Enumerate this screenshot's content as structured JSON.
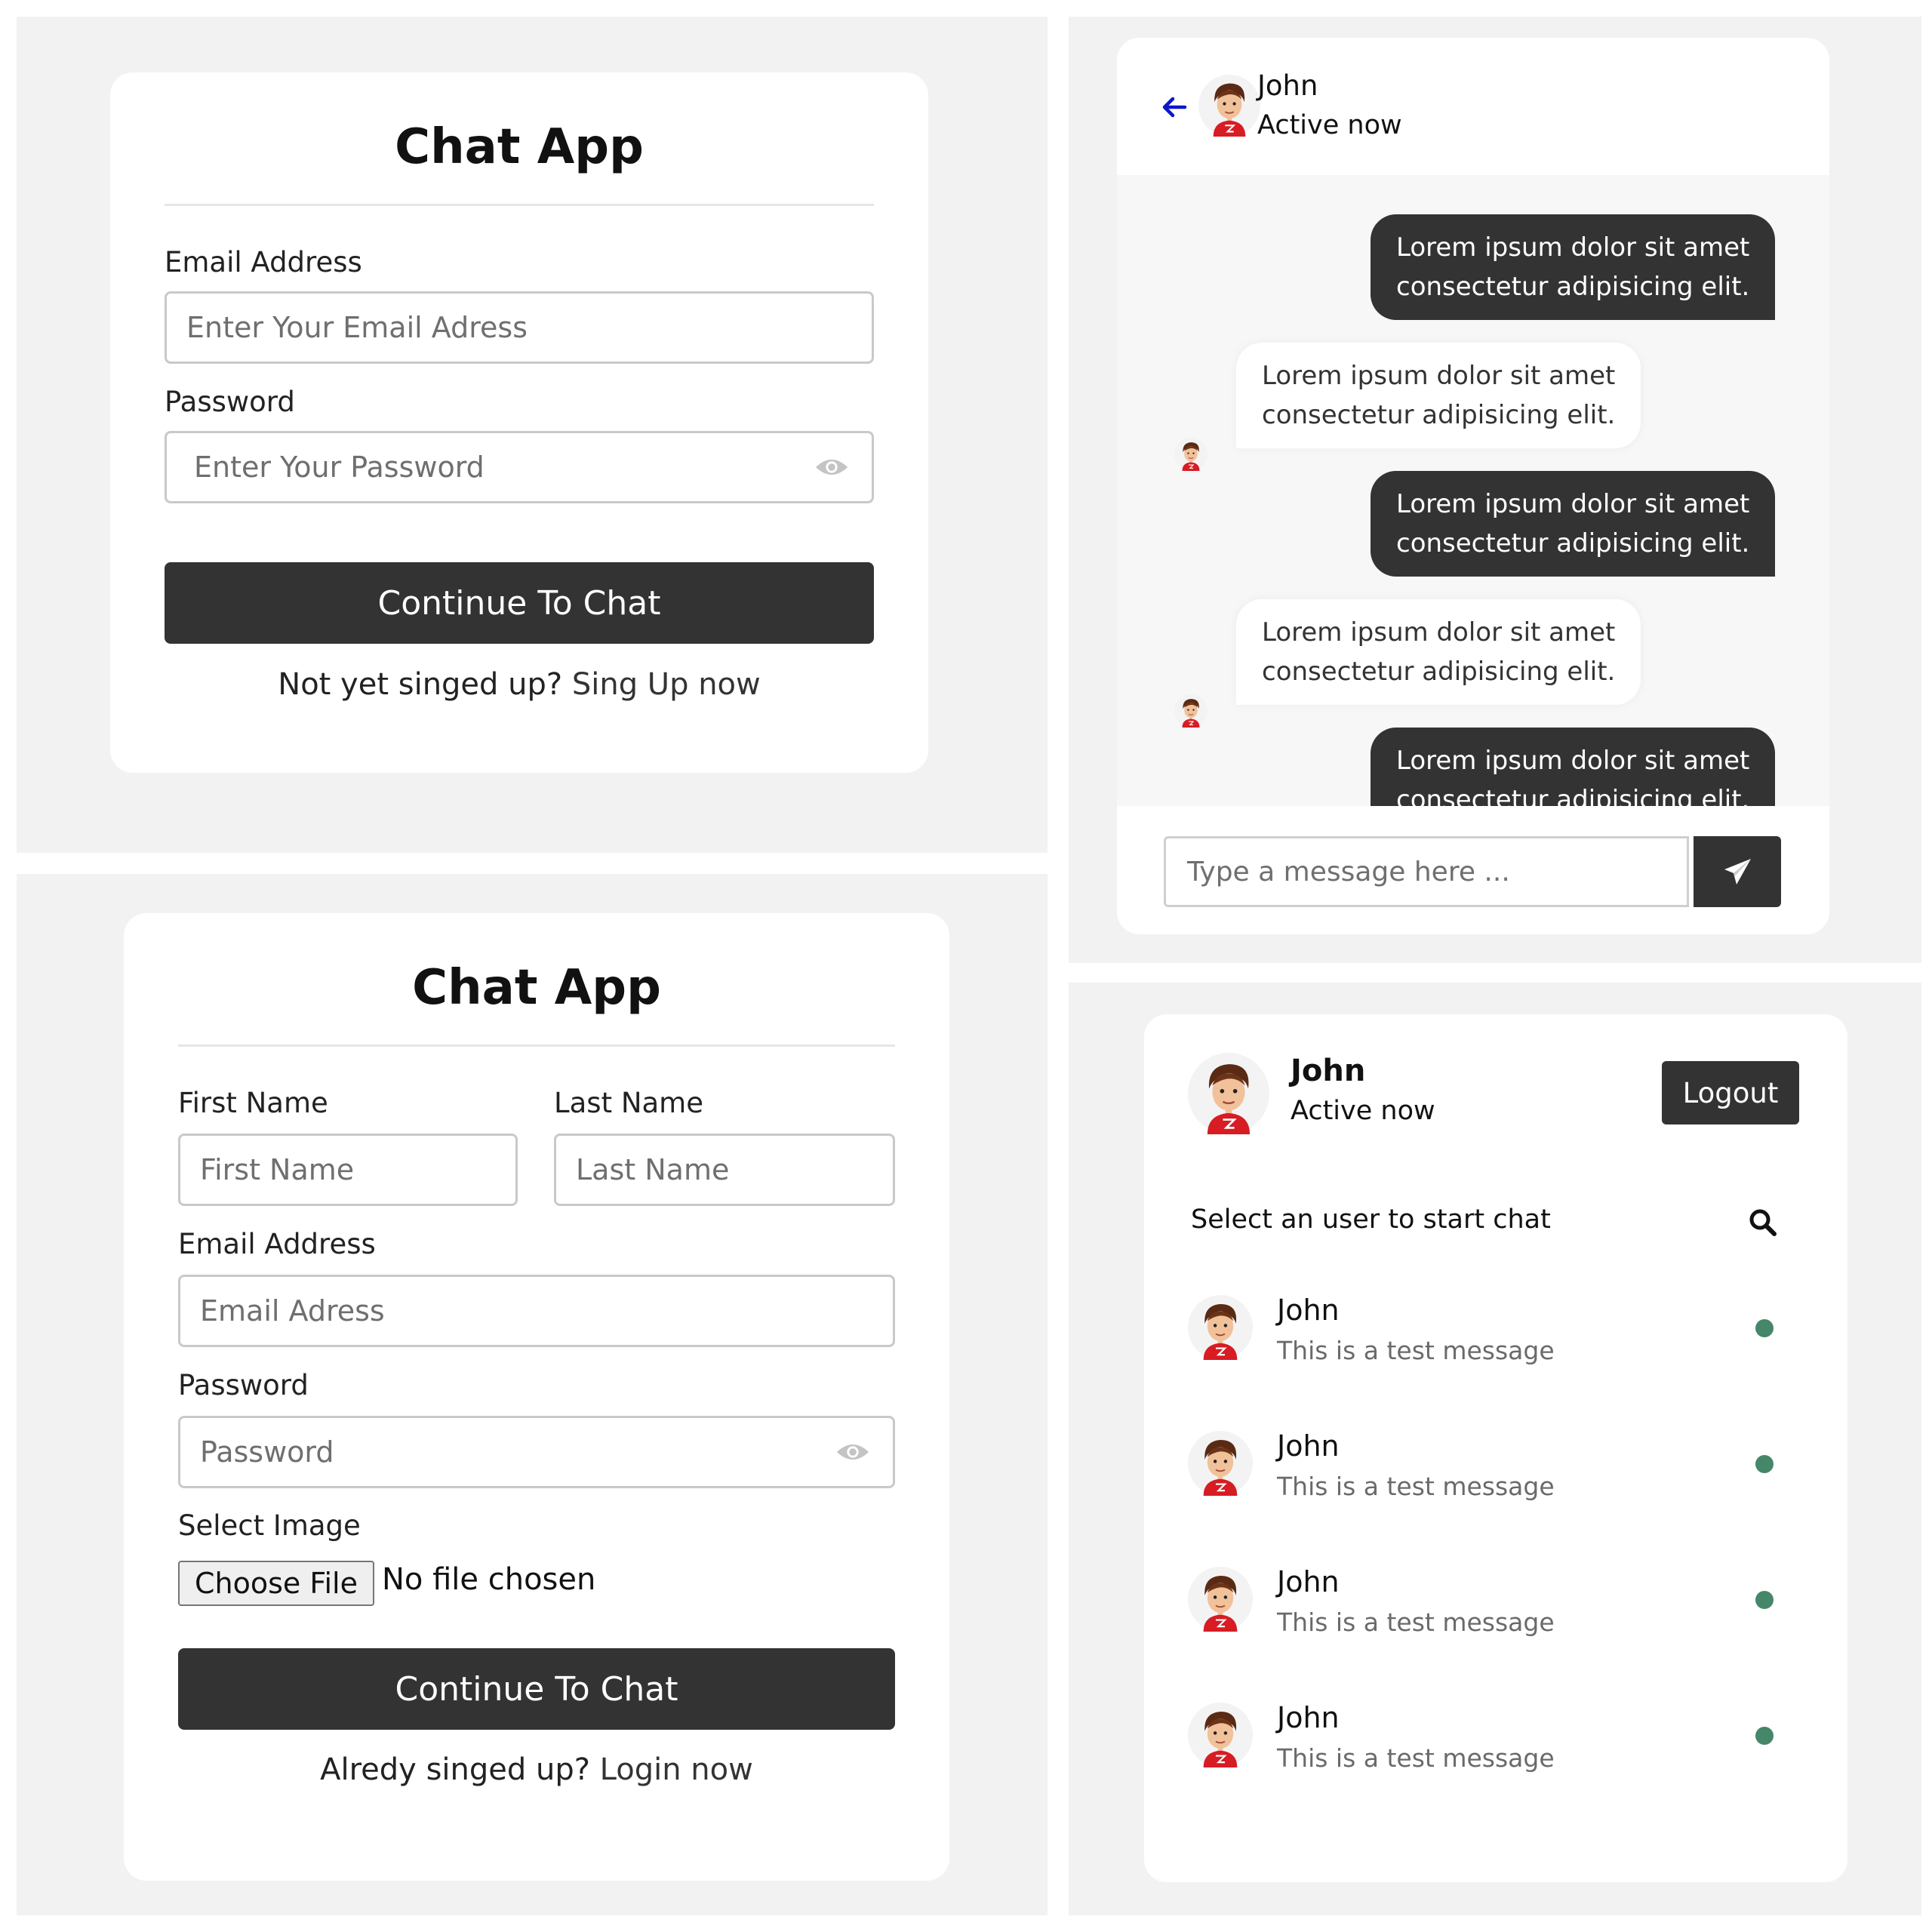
{
  "colors": {
    "accent_dark": "#333333",
    "online_dot": "#468669",
    "back_arrow": "#0c17c8"
  },
  "login": {
    "title": "Chat App",
    "email_label": "Email Address",
    "email_placeholder": "Enter Your Email Adress",
    "password_label": "Password",
    "password_placeholder": "Enter Your Password",
    "submit_label": "Continue To Chat",
    "footer_text": "Not yet singed up?",
    "footer_link": "Sing Up now"
  },
  "signup": {
    "title": "Chat App",
    "first_name_label": "First Name",
    "first_name_placeholder": "First Name",
    "last_name_label": "Last Name",
    "last_name_placeholder": "Last Name",
    "email_label": "Email Address",
    "email_placeholder": "Email Adress",
    "password_label": "Password",
    "password_placeholder": "Password",
    "image_label": "Select Image",
    "file_button_label": "Choose File",
    "file_status": "No file chosen",
    "submit_label": "Continue To Chat",
    "footer_text": "Alredy singed up?",
    "footer_link": "Login now"
  },
  "chat": {
    "header": {
      "name": "John",
      "status": "Active now"
    },
    "messages": [
      {
        "dir": "out",
        "line1": "Lorem ipsum dolor sit amet",
        "line2": "consectetur adipisicing elit."
      },
      {
        "dir": "in",
        "line1": "Lorem ipsum dolor sit amet",
        "line2": "consectetur adipisicing elit."
      },
      {
        "dir": "out",
        "line1": "Lorem ipsum dolor sit amet",
        "line2": "consectetur adipisicing elit."
      },
      {
        "dir": "in",
        "line1": "Lorem ipsum dolor sit amet",
        "line2": "consectetur adipisicing elit."
      },
      {
        "dir": "out",
        "line1": "Lorem ipsum dolor sit amet",
        "line2": "consectetur adipisicing elit."
      }
    ],
    "input_placeholder": "Type a message here ...",
    "send_icon": "paper-plane-icon"
  },
  "users": {
    "header": {
      "name": "John",
      "status": "Active now",
      "logout_label": "Logout"
    },
    "search_label": "Select an user to start chat",
    "list": [
      {
        "name": "John",
        "message": "This is a test message"
      },
      {
        "name": "John",
        "message": "This is a test message"
      },
      {
        "name": "John",
        "message": "This is a test message"
      },
      {
        "name": "John",
        "message": "This is a test message"
      }
    ]
  }
}
